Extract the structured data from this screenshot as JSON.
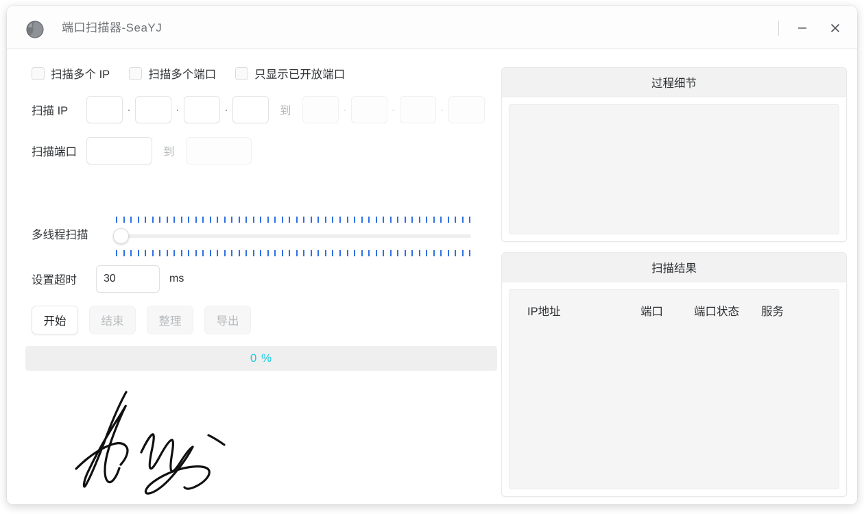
{
  "window": {
    "title": "端口扫描器-SeaYJ",
    "app_icon": "globe-icon",
    "minimize_label": "−",
    "close_label": "×"
  },
  "options": {
    "checkboxes": [
      {
        "label": "扫描多个 IP",
        "checked": false
      },
      {
        "label": "扫描多个端口",
        "checked": false
      },
      {
        "label": "只显示已开放端口",
        "checked": false
      }
    ]
  },
  "scan_ip": {
    "label": "扫描 IP",
    "separator": "到",
    "dot": "·",
    "start_octets": [
      "",
      "",
      "",
      ""
    ],
    "end_octets": [
      "",
      "",
      "",
      ""
    ]
  },
  "scan_port": {
    "label": "扫描端口",
    "separator": "到",
    "start_value": "",
    "end_value": ""
  },
  "threads": {
    "label": "多线程扫描",
    "value": 0,
    "tick_count": 50
  },
  "timeout": {
    "label": "设置超时",
    "value": "30",
    "unit": "ms"
  },
  "buttons": [
    {
      "label": "开始",
      "enabled": true
    },
    {
      "label": "结束",
      "enabled": false
    },
    {
      "label": "整理",
      "enabled": false
    },
    {
      "label": "导出",
      "enabled": false
    }
  ],
  "progress": {
    "text": "0 %",
    "percent": 0,
    "color": "#15cde2"
  },
  "signature": {
    "name": "handwritten-signature"
  },
  "detail_panel": {
    "title": "过程细节",
    "content": ""
  },
  "result_panel": {
    "title": "扫描结果",
    "columns": [
      "IP地址",
      "端口",
      "端口状态",
      "服务"
    ],
    "rows": []
  }
}
